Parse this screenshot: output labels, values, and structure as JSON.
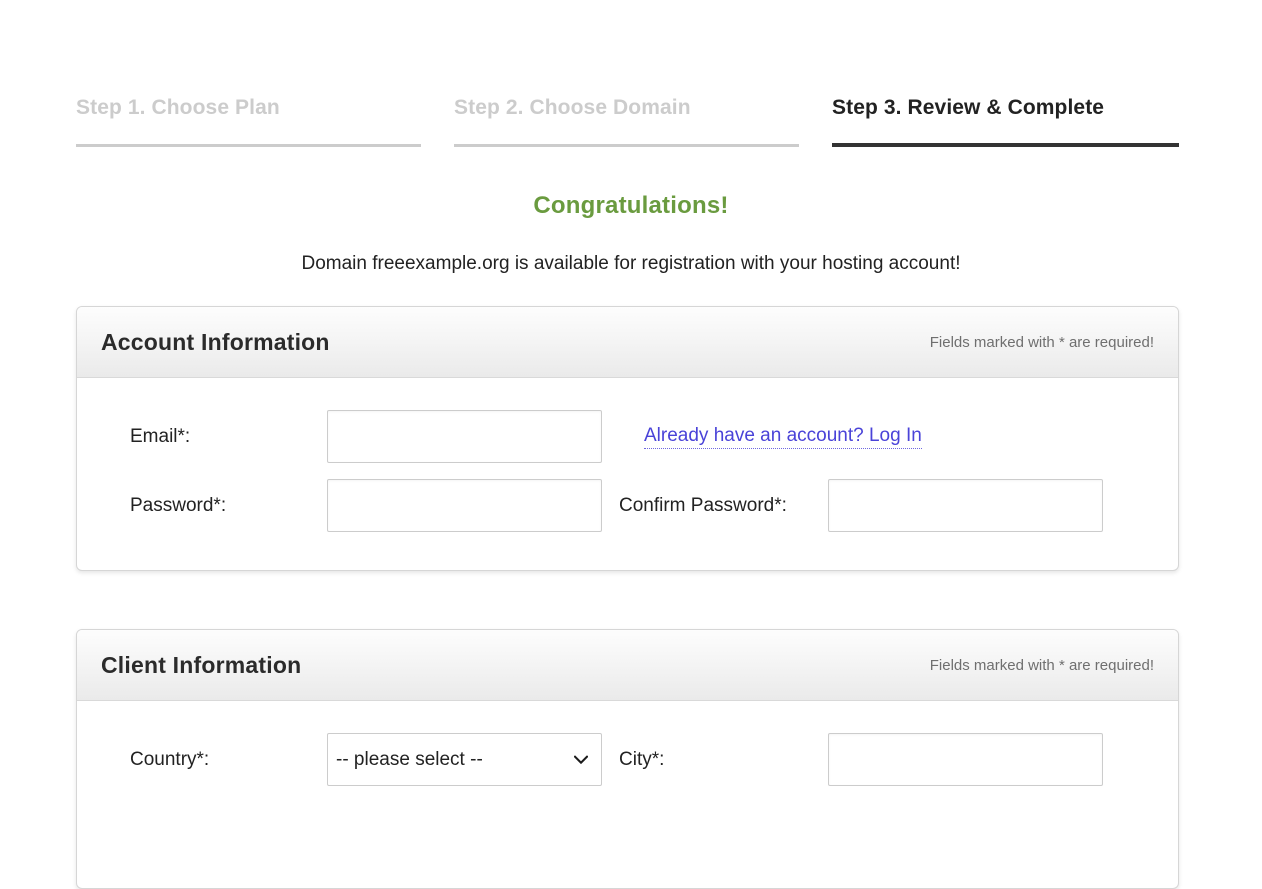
{
  "stepper": {
    "steps": [
      {
        "label": "Step 1. Choose Plan",
        "state": "inactive"
      },
      {
        "label": "Step 2. Choose Domain",
        "state": "inactive"
      },
      {
        "label": "Step 3. Review & Complete",
        "state": "active"
      }
    ]
  },
  "message": {
    "headline": "Congratulations!",
    "headline_color": "#6a9b3f",
    "detail": "Domain freeexample.org is available for registration with your hosting account!"
  },
  "account_panel": {
    "title": "Account Information",
    "note": "Fields marked with * are required!",
    "fields": {
      "email_label": "Email*:",
      "email_value": "",
      "email_placeholder": "",
      "password_label": "Password*:",
      "password_value": "",
      "password_placeholder": "",
      "confirm_password_label": "Confirm Password*:",
      "confirm_password_value": "",
      "confirm_password_placeholder": ""
    },
    "login_link": "Already have an account? Log In",
    "login_link_color": "#4a43d8"
  },
  "client_panel": {
    "title": "Client Information",
    "note": "Fields marked with * are required!",
    "fields": {
      "country_label": "Country*:",
      "country_selected": "-- please select --",
      "country_options": [
        "-- please select --"
      ],
      "city_label": "City*:",
      "city_value": "",
      "city_placeholder": ""
    },
    "chevron_icon": "chevron-down-icon"
  }
}
